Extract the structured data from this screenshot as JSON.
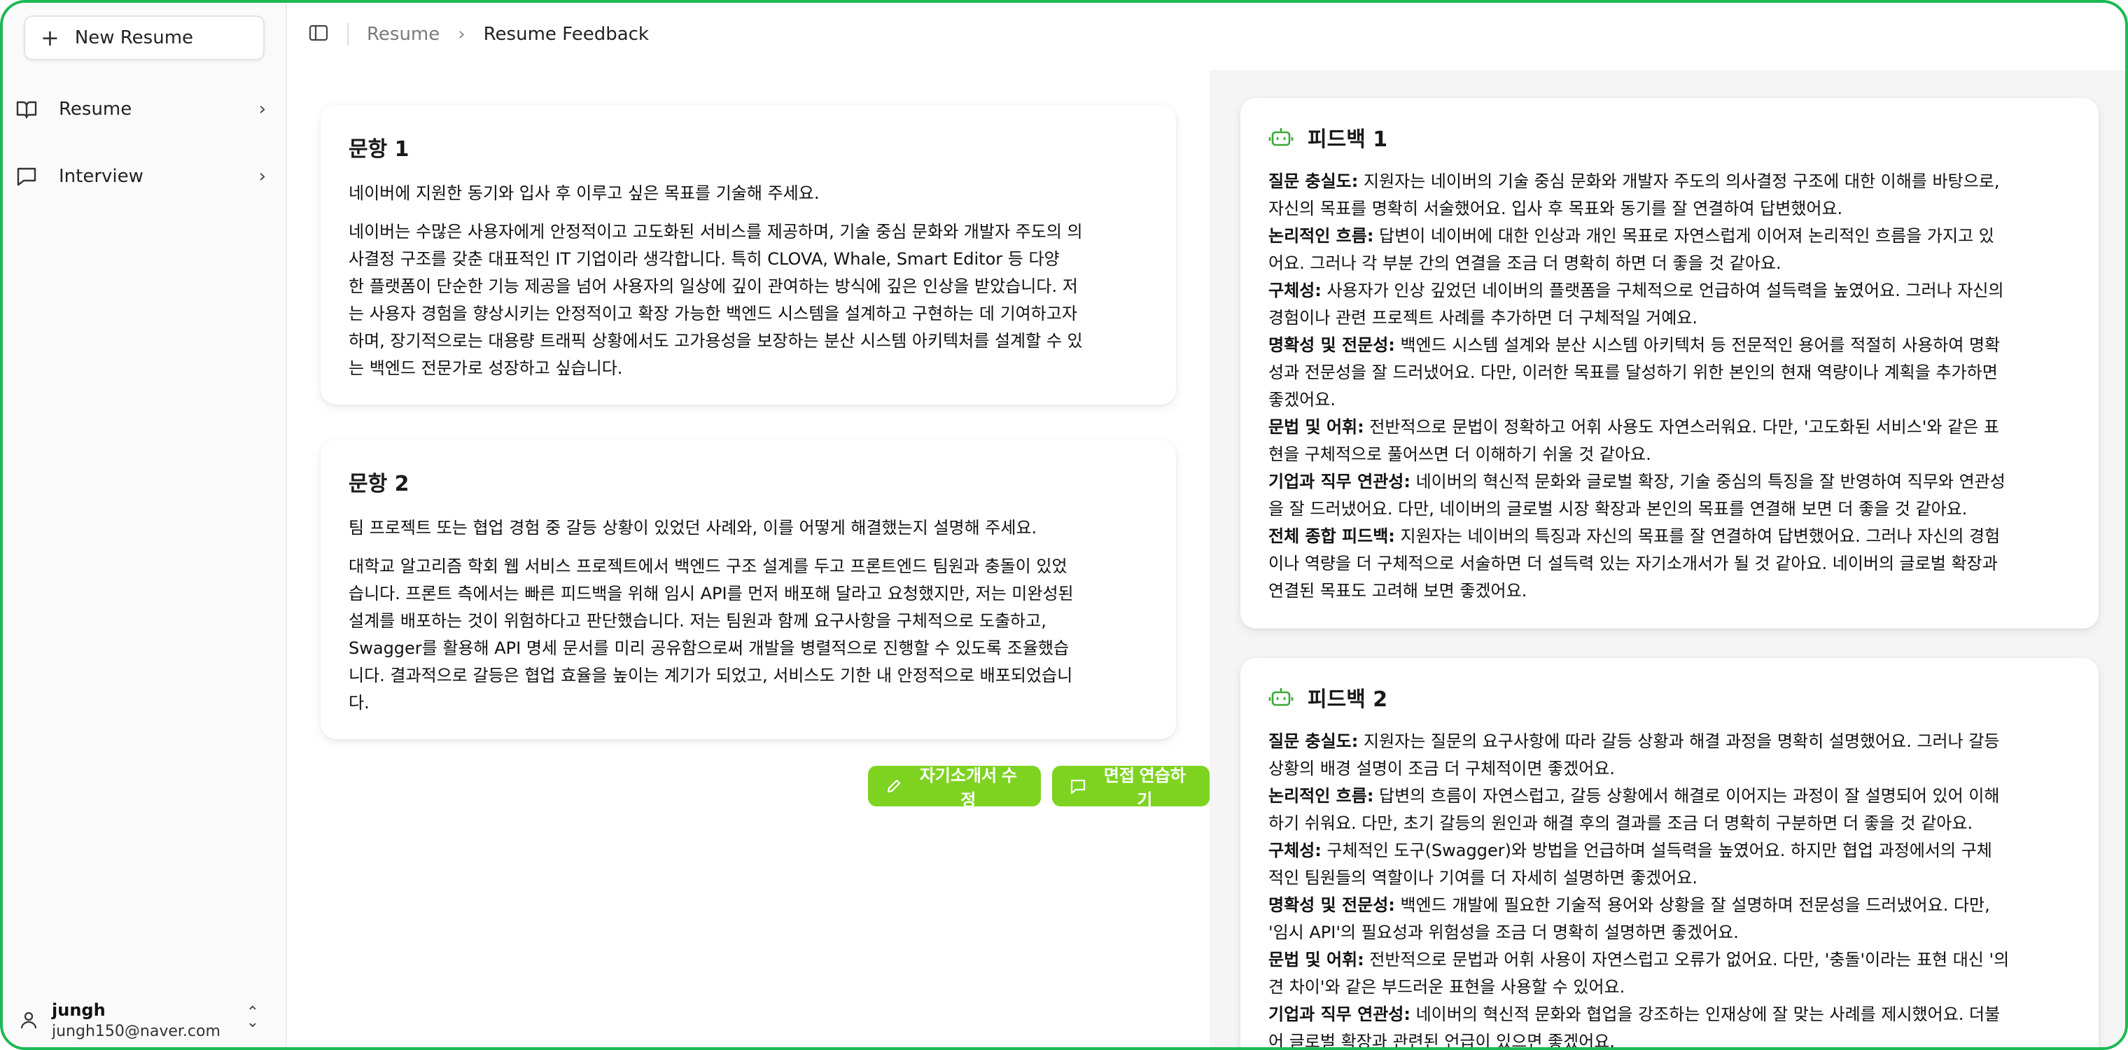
{
  "sidebar": {
    "new_resume_label": "New Resume",
    "items": [
      {
        "label": "Resume"
      },
      {
        "label": "Interview"
      }
    ],
    "user": {
      "name": "jungh",
      "email": "jungh150@naver.com"
    }
  },
  "header": {
    "crumb_parent": "Resume",
    "crumb_current": "Resume Feedback"
  },
  "questions": [
    {
      "title": "문항 1",
      "question": "네이버에 지원한 동기와 입사 후 이루고 싶은 목표를 기술해 주세요.",
      "answer_lines": [
        "네이버는 수많은 사용자에게 안정적이고 고도화된 서비스를 제공하며, 기술 중심 문화와 개발자 주도의 의",
        "사결정 구조를 갖춘 대표적인 IT 기업이라 생각합니다. 특히 CLOVA, Whale, Smart Editor 등 다양",
        "한 플랫폼이 단순한 기능 제공을 넘어 사용자의 일상에 깊이 관여하는 방식에 깊은 인상을 받았습니다. 저",
        "는 사용자 경험을 향상시키는 안정적이고 확장 가능한 백엔드 시스템을 설계하고 구현하는 데 기여하고자",
        "하며, 장기적으로는 대용량 트래픽 상황에서도 고가용성을 보장하는 분산 시스템 아키텍처를 설계할 수 있",
        "는 백엔드 전문가로 성장하고 싶습니다."
      ]
    },
    {
      "title": "문항 2",
      "question": "팀 프로젝트 또는 협업 경험 중 갈등 상황이 있었던 사례와, 이를 어떻게 해결했는지 설명해 주세요.",
      "answer_lines": [
        "대학교 알고리즘 학회 웹 서비스 프로젝트에서 백엔드 구조 설계를 두고 프론트엔드 팀원과 충돌이 있었",
        "습니다. 프론트 측에서는 빠른 피드백을 위해 임시 API를 먼저 배포해 달라고 요청했지만, 저는 미완성된",
        "설계를 배포하는 것이 위험하다고 판단했습니다. 저는 팀원과 함께 요구사항을 구체적으로 도출하고,",
        "Swagger를 활용해 API 명세 문서를 미리 공유함으로써 개발을 병렬적으로 진행할 수 있도록 조율했습",
        "니다. 결과적으로 갈등은 협업 효율을 높이는 계기가 되었고, 서비스도 기한 내 안정적으로 배포되었습니",
        "다."
      ]
    }
  ],
  "actions": {
    "edit_label": "자기소개서 수정",
    "interview_label": "면접 연습하기"
  },
  "feedback": [
    {
      "title": "피드백 1",
      "lines": [
        {
          "k": "질문 충실도:",
          "t": " 지원자는 네이버의 기술 중심 문화와 개발자 주도의 의사결정 구조에 대한 이해를 바탕으로,"
        },
        {
          "k": "",
          "t": "자신의 목표를 명확히 서술했어요. 입사 후 목표와 동기를 잘 연결하여 답변했어요."
        },
        {
          "k": "논리적인 흐름:",
          "t": " 답변이 네이버에 대한 인상과 개인 목표로 자연스럽게 이어져 논리적인 흐름을 가지고 있"
        },
        {
          "k": "",
          "t": "어요. 그러나 각 부분 간의 연결을 조금 더 명확히 하면 더 좋을 것 같아요."
        },
        {
          "k": "구체성:",
          "t": " 사용자가 인상 깊었던 네이버의 플랫폼을 구체적으로 언급하여 설득력을 높였어요. 그러나 자신의"
        },
        {
          "k": "",
          "t": "경험이나 관련 프로젝트 사례를 추가하면 더 구체적일 거예요."
        },
        {
          "k": "명확성 및 전문성:",
          "t": " 백엔드 시스템 설계와 분산 시스템 아키텍처 등 전문적인 용어를 적절히 사용하여 명확"
        },
        {
          "k": "",
          "t": "성과 전문성을 잘 드러냈어요. 다만, 이러한 목표를 달성하기 위한 본인의 현재 역량이나 계획을 추가하면"
        },
        {
          "k": "",
          "t": "좋겠어요."
        },
        {
          "k": "문법 및 어휘:",
          "t": " 전반적으로 문법이 정확하고 어휘 사용도 자연스러워요. 다만, '고도화된 서비스'와 같은 표"
        },
        {
          "k": "",
          "t": "현을 구체적으로 풀어쓰면 더 이해하기 쉬울 것 같아요."
        },
        {
          "k": "기업과 직무 연관성:",
          "t": " 네이버의 혁신적 문화와 글로벌 확장, 기술 중심의 특징을 잘 반영하여 직무와 연관성"
        },
        {
          "k": "",
          "t": "을 잘 드러냈어요. 다만, 네이버의 글로벌 시장 확장과 본인의 목표를 연결해 보면 더 좋을 것 같아요."
        },
        {
          "k": "전체 종합 피드백:",
          "t": " 지원자는 네이버의 특징과 자신의 목표를 잘 연결하여 답변했어요. 그러나 자신의 경험"
        },
        {
          "k": "",
          "t": "이나 역량을 더 구체적으로 서술하면 더 설득력 있는 자기소개서가 될 것 같아요. 네이버의 글로벌 확장과"
        },
        {
          "k": "",
          "t": "연결된 목표도 고려해 보면 좋겠어요."
        }
      ]
    },
    {
      "title": "피드백 2",
      "lines": [
        {
          "k": "질문 충실도:",
          "t": " 지원자는 질문의 요구사항에 따라 갈등 상황과 해결 과정을 명확히 설명했어요. 그러나 갈등"
        },
        {
          "k": "",
          "t": "상황의 배경 설명이 조금 더 구체적이면 좋겠어요."
        },
        {
          "k": "논리적인 흐름:",
          "t": " 답변의 흐름이 자연스럽고, 갈등 상황에서 해결로 이어지는 과정이 잘 설명되어 있어 이해"
        },
        {
          "k": "",
          "t": "하기 쉬워요. 다만, 초기 갈등의 원인과 해결 후의 결과를 조금 더 명확히 구분하면 더 좋을 것 같아요."
        },
        {
          "k": "구체성:",
          "t": " 구체적인 도구(Swagger)와 방법을 언급하며 설득력을 높였어요. 하지만 협업 과정에서의 구체"
        },
        {
          "k": "",
          "t": "적인 팀원들의 역할이나 기여를 더 자세히 설명하면 좋겠어요."
        },
        {
          "k": "명확성 및 전문성:",
          "t": " 백엔드 개발에 필요한 기술적 용어와 상황을 잘 설명하며 전문성을 드러냈어요. 다만,"
        },
        {
          "k": "",
          "t": "'임시 API'의 필요성과 위험성을 조금 더 명확히 설명하면 좋겠어요."
        },
        {
          "k": "문법 및 어휘:",
          "t": " 전반적으로 문법과 어휘 사용이 자연스럽고 오류가 없어요. 다만, '충돌'이라는 표현 대신 '의"
        },
        {
          "k": "",
          "t": "견 차이'와 같은 부드러운 표현을 사용할 수 있어요."
        },
        {
          "k": "기업과 직무 연관성:",
          "t": " 네이버의 혁신적 문화와 협업을 강조하는 인재상에 잘 맞는 사례를 제시했어요. 더불"
        },
        {
          "k": "",
          "t": "어 글로벌 확장과 관련된 언급이 있으면 좋겠어요."
        }
      ]
    }
  ]
}
